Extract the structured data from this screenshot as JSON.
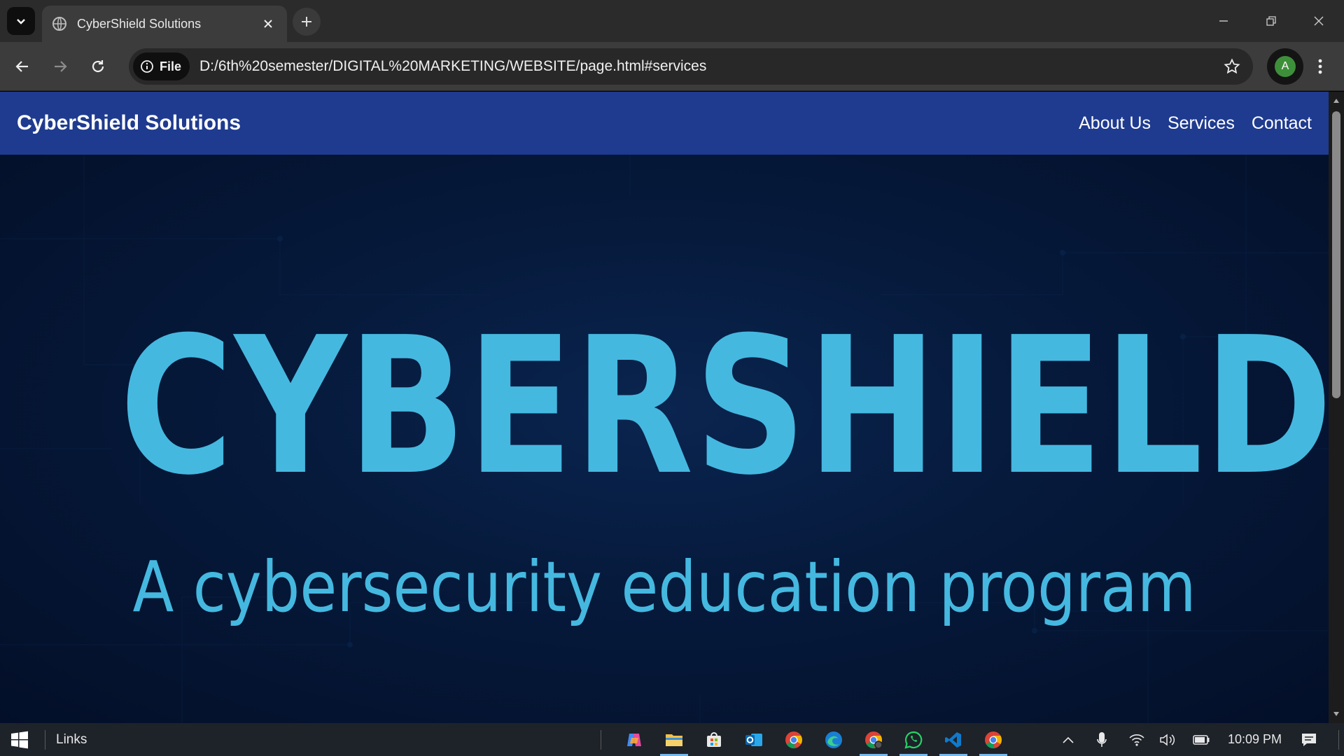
{
  "browser": {
    "tab_title": "CyberShield Solutions",
    "address_chip": "File",
    "url": "D:/6th%20semester/DIGITAL%20MARKETING/WEBSITE/page.html#services",
    "profile_initial": "A"
  },
  "site": {
    "brand": "CyberShield Solutions",
    "nav": [
      "About Us",
      "Services",
      "Contact"
    ],
    "hero_title": "CYBERSHIELD",
    "hero_subtitle": "A cybersecurity education program"
  },
  "taskbar": {
    "toolbar_label": "Links",
    "clock": "10:09 PM",
    "apps": [
      "copilot-icon",
      "file-explorer-icon",
      "microsoft-store-icon",
      "outlook-icon",
      "chrome-icon",
      "edge-icon",
      "chrome-profile-icon",
      "whatsapp-icon",
      "vscode-icon",
      "chrome-alt-icon"
    ]
  },
  "colors": {
    "header_bg": "#1f3b8f",
    "hero_text": "#45b8e0",
    "hero_bg": "#061a3c"
  }
}
